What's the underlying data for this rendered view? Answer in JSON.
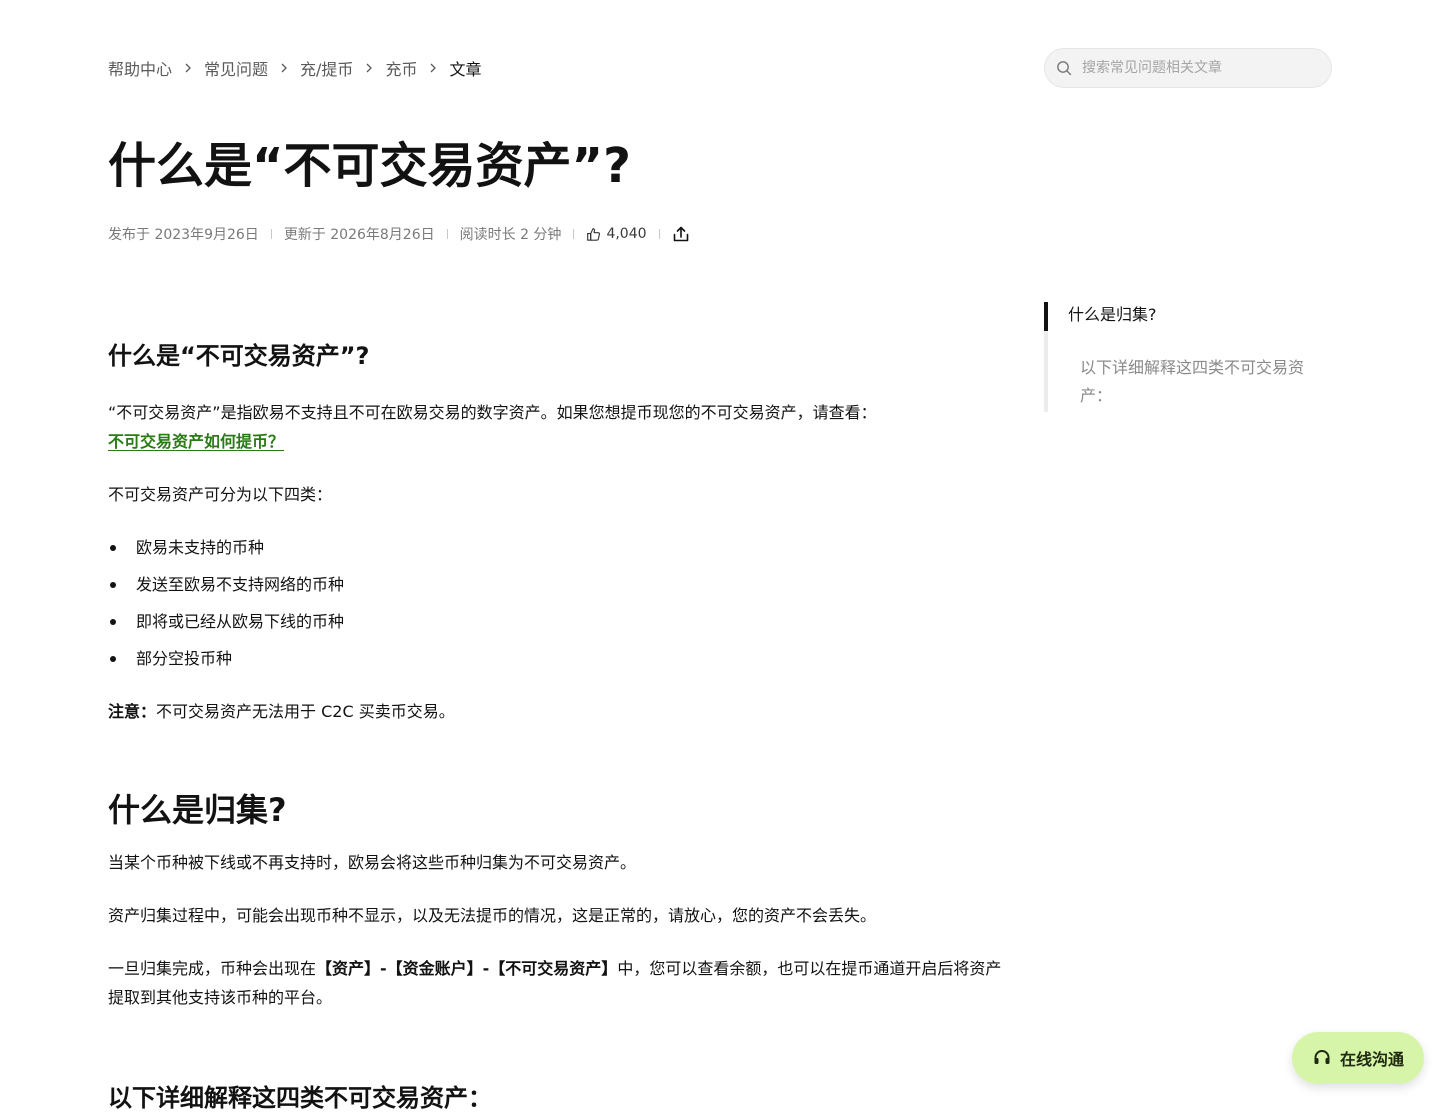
{
  "breadcrumb": [
    "帮助中心",
    "常见问题",
    "充/提币",
    "充币",
    "文章"
  ],
  "search": {
    "placeholder": "搜索常见问题相关文章"
  },
  "title": "什么是“不可交易资产”?",
  "meta": {
    "published": "发布于 2023年9月26日",
    "updated": "更新于 2026年8月26日",
    "read_time": "阅读时长 2 分钟",
    "likes": "4,040"
  },
  "content": {
    "h1": "什么是“不可交易资产”?",
    "p1": "“不可交易资产”是指欧易不支持且不可在欧易交易的数字资产。如果您想提币现您的不可交易资产，请查看：",
    "link": "不可交易资产如何提币？",
    "p2": "不可交易资产可分为以下四类：",
    "list": [
      "欧易未支持的币种",
      "发送至欧易不支持网络的币种",
      "即将或已经从欧易下线的币种",
      "部分空投币种"
    ],
    "note_label": "注意：",
    "note_text": "不可交易资产无法用于 C2C 买卖币交易。",
    "h2": "什么是归集?",
    "p3": "当某个币种被下线或不再支持时，欧易会将这些币种归集为不可交易资产。",
    "p4": "资产归集过程中，可能会出现币种不显示，以及无法提币的情况，这是正常的，请放心，您的资产不会丢失。",
    "p5_a": "一旦归集完成，币种会出现在",
    "p5_b": "【资产】-【资金账户】-【不可交易资产】",
    "p5_c": "中，您可以查看余额，也可以在提币通道开启后将资产提取到其他支持该币种的平台。",
    "h3": "以下详细解释这四类不可交易资产："
  },
  "toc": [
    "什么是归集?",
    "以下详细解释这四类不可交易资产："
  ],
  "chat": {
    "label": "在线沟通"
  },
  "colors": {
    "link": "#2a7b16",
    "chat_bg": "#d7f5a9"
  }
}
